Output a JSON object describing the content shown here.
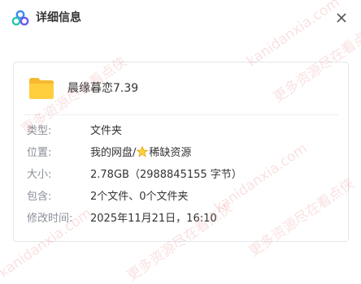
{
  "header": {
    "title": "详细信息"
  },
  "file": {
    "name": "晨缘暮恋7.39"
  },
  "details": {
    "type_label": "类型:",
    "type_value": "文件夹",
    "location_label": "位置:",
    "location_prefix": "我的网盘/",
    "location_suffix": "稀缺资源",
    "size_label": "大小:",
    "size_value": "2.78GB（2988845155 字节）",
    "contains_label": "包含:",
    "contains_value": "2个文件、0个文件夹",
    "modified_label": "修改时间:",
    "modified_value": "2025年11月21日，16:10"
  },
  "watermark": {
    "text1": "kanidanxia.com",
    "text2": "更多资源尽在看点侠"
  }
}
